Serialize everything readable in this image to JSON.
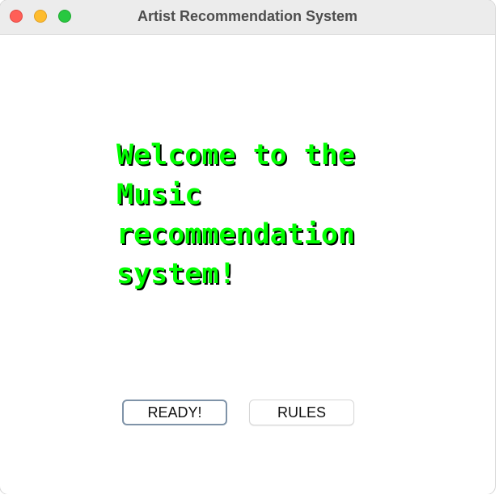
{
  "window": {
    "title": "Artist Recommendation System"
  },
  "main": {
    "welcome_lines": [
      "Welcome to the",
      "Music",
      "recommendation",
      "system!"
    ]
  },
  "buttons": {
    "ready_label": "READY!",
    "rules_label": "RULES"
  },
  "colors": {
    "welcome_text": "#00ff00",
    "welcome_shadow": "#000000",
    "close": "#ff5f57",
    "minimize": "#febc2e",
    "maximize": "#28c840"
  }
}
